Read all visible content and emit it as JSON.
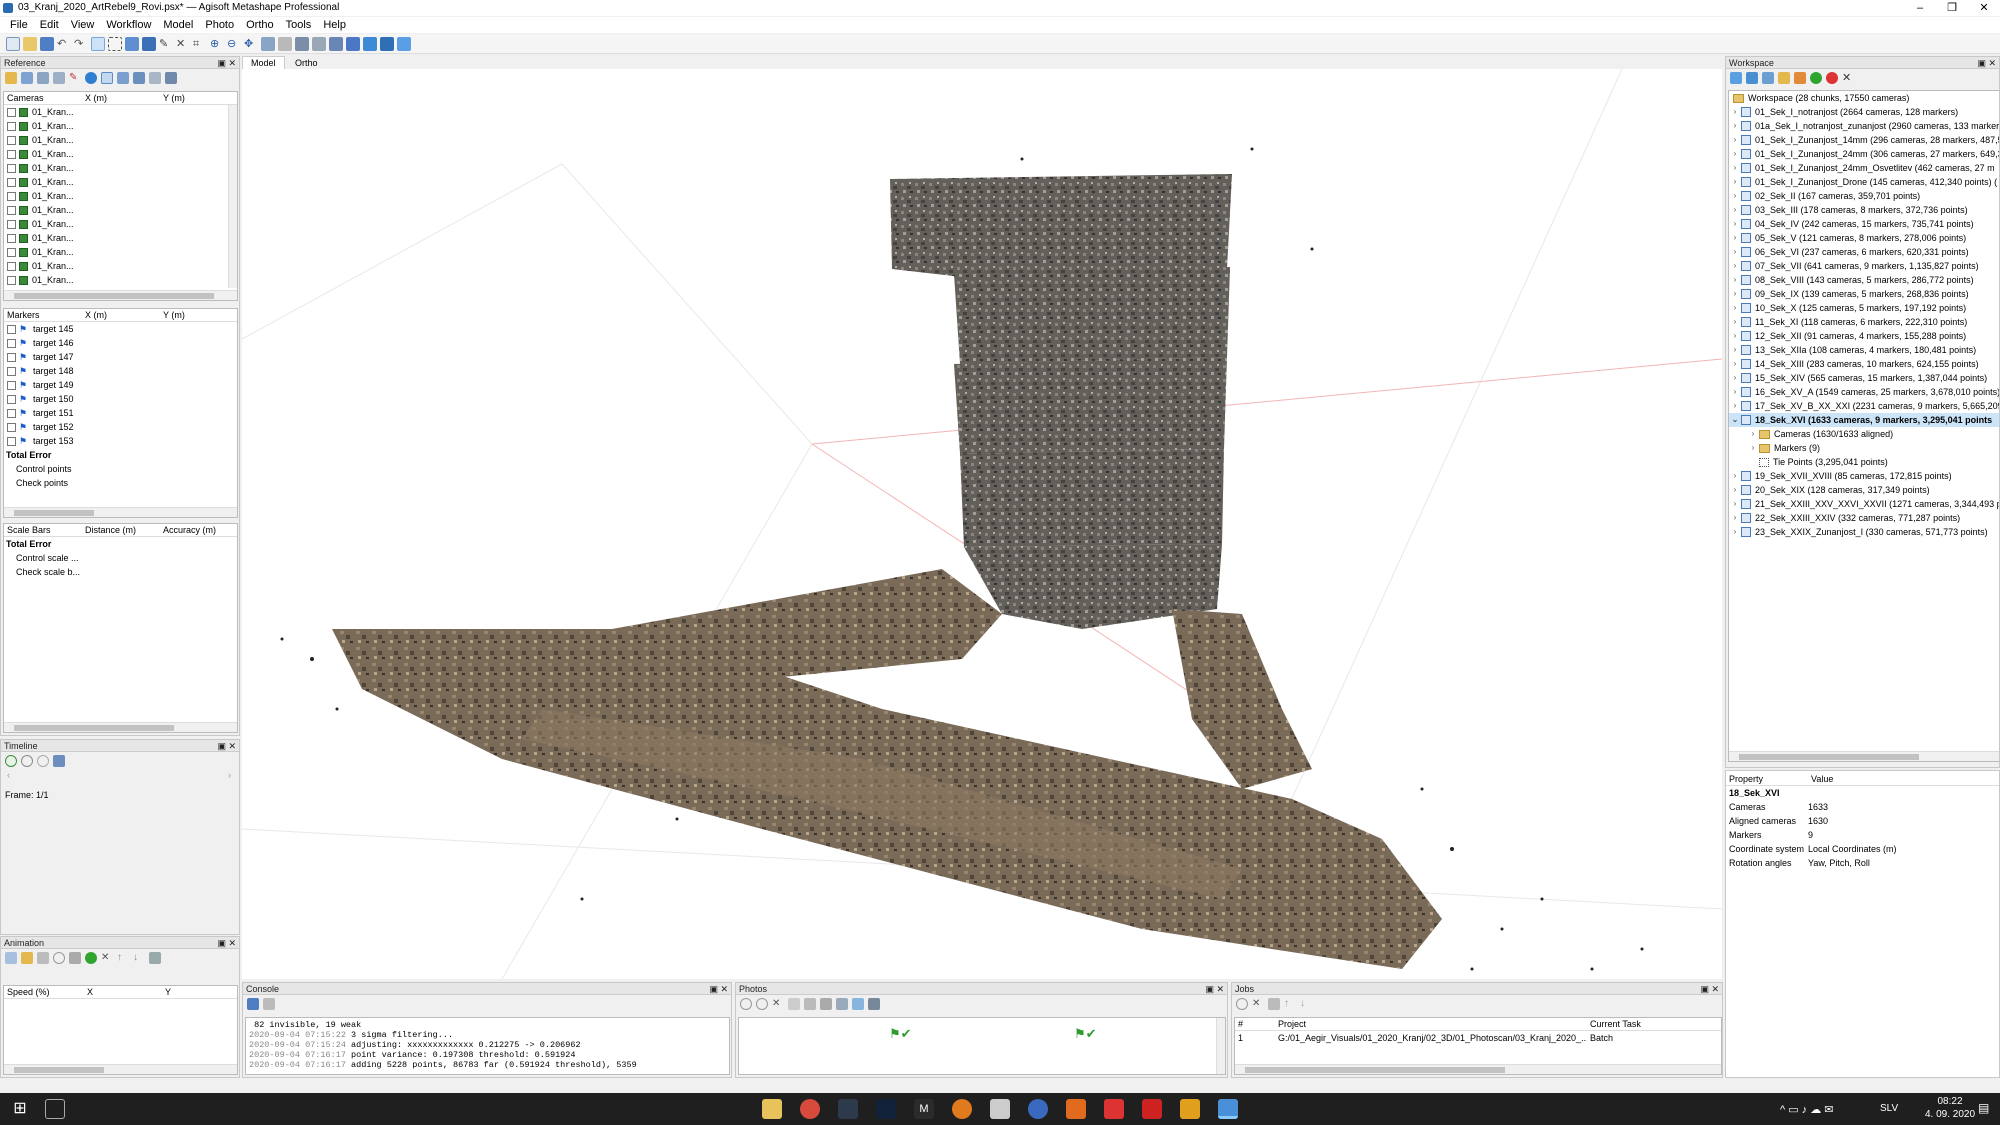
{
  "window": {
    "title": "03_Kranj_2020_ArtRebel9_Rovi.psx* — Agisoft Metashape Professional",
    "controls": [
      "–",
      "❐",
      "✕"
    ]
  },
  "menu": [
    "File",
    "Edit",
    "View",
    "Workflow",
    "Model",
    "Photo",
    "Ortho",
    "Tools",
    "Help"
  ],
  "view_tabs": [
    "Model",
    "Ortho"
  ],
  "reference": {
    "title": "Reference",
    "cameras_headers": [
      "Cameras",
      "X (m)",
      "Y (m)"
    ],
    "cameras": [
      "01_Kran...",
      "01_Kran...",
      "01_Kran...",
      "01_Kran...",
      "01_Kran...",
      "01_Kran...",
      "01_Kran...",
      "01_Kran...",
      "01_Kran...",
      "01_Kran...",
      "01_Kran...",
      "01_Kran...",
      "01_Kran..."
    ],
    "markers_headers": [
      "Markers",
      "X (m)",
      "Y (m)"
    ],
    "markers": [
      "target 145",
      "target 146",
      "target 147",
      "target 148",
      "target 149",
      "target 150",
      "target 151",
      "target 152",
      "target 153"
    ],
    "markers_total": "Total Error",
    "markers_sub": [
      "Control points",
      "Check points"
    ],
    "scalebars_headers": [
      "Scale Bars",
      "Distance (m)",
      "Accuracy (m)"
    ],
    "scalebars_total": "Total Error",
    "scalebars_sub": [
      "Control scale ...",
      "Check scale b..."
    ]
  },
  "timeline": {
    "title": "Timeline",
    "frame": "Frame: 1/1"
  },
  "animation": {
    "title": "Animation",
    "headers": [
      "Speed (%)",
      "X",
      "Y"
    ]
  },
  "console": {
    "title": "Console",
    "lines": [
      {
        "ts": "",
        "text": "82 invisible, 19 weak"
      },
      {
        "ts": "2020-09-04 07:15:22",
        "text": "3 sigma filtering..."
      },
      {
        "ts": "2020-09-04 07:15:24",
        "text": "adjusting: xxxxxxxxxxxxx 0.212275 -> 0.206962"
      },
      {
        "ts": "2020-09-04 07:16:17",
        "text": "point variance: 0.197308 threshold: 0.591924"
      },
      {
        "ts": "2020-09-04 07:16:17",
        "text": "adding 5228 points, 86783 far (0.591924 threshold), 5359"
      }
    ]
  },
  "photos": {
    "title": "Photos"
  },
  "jobs": {
    "title": "Jobs",
    "headers": [
      "#",
      "Project",
      "Current Task"
    ],
    "rows": [
      {
        "num": "1",
        "project": "G:/01_Aegir_Visuals/01_2020_Kranj/02_3D/01_Photoscan/03_Kranj_2020_...",
        "task": "Batch"
      }
    ]
  },
  "workspace": {
    "title": "Workspace",
    "root": "Workspace (28 chunks, 17550 cameras)",
    "chunks": [
      "01_Sek_I_notranjost (2664 cameras, 128 markers)",
      "01a_Sek_I_notranjost_zunanjost (2960 cameras, 133 markers",
      "01_Sek_I_Zunanjost_14mm (296 cameras, 28 markers, 487,5",
      "01_Sek_I_Zunanjost_24mm (306 cameras, 27 markers, 649,3",
      "01_Sek_I_Zunanjost_24mm_Osvetlitev (462 cameras, 27 m",
      "01_Sek_I_Zunanjost_Drone (145 cameras, 412,340 points) (",
      "02_Sek_II (167 cameras, 359,701 points)",
      "03_Sek_III (178 cameras, 8 markers, 372,736 points)",
      "04_Sek_IV (242 cameras, 15 markers, 735,741 points)",
      "05_Sek_V (121 cameras, 8 markers, 278,006 points)",
      "06_Sek_VI (237 cameras, 6 markers, 620,331 points)",
      "07_Sek_VII (641 cameras, 9 markers, 1,135,827 points)",
      "08_Sek_VIII (143 cameras, 5 markers, 286,772 points)",
      "09_Sek_IX (139 cameras, 5 markers, 268,836 points)",
      "10_Sek_X (125 cameras, 5 markers, 197,192 points)",
      "11_Sek_XI (118 cameras, 6 markers, 222,310 points)",
      "12_Sek_XII (91 cameras, 4 markers, 155,288 points)",
      "13_Sek_XIIa (108 cameras, 4 markers, 180,481 points)",
      "14_Sek_XIII (283 cameras, 10 markers, 624,155 points)",
      "15_Sek_XIV (565 cameras, 15 markers, 1,387,044 points)",
      "16_Sek_XV_A (1549 cameras, 25 markers, 3,678,010 points)",
      "17_Sek_XV_B_XX_XXI (2231 cameras, 9 markers, 5,665,209 p"
    ],
    "selected_chunk": "18_Sek_XVI (1633 cameras, 9 markers, 3,295,041 points",
    "selected_children": [
      "Cameras (1630/1633 aligned)",
      "Markers (9)",
      "Tie Points (3,295,041 points)"
    ],
    "chunks_after": [
      "19_Sek_XVII_XVIII (85 cameras, 172,815 points)",
      "20_Sek_XIX (128 cameras, 317,349 points)",
      "21_Sek_XXIII_XXV_XXVI_XXVII (1271 cameras, 3,344,493 poin",
      "22_Sek_XXIII_XXIV (332 cameras, 771,287 points)",
      "23_Sek_XXIX_Zunanjost_I (330 cameras, 571,773 points)"
    ]
  },
  "properties": {
    "headers": [
      "Property",
      "Value"
    ],
    "chunk_name": "18_Sek_XVI",
    "rows": [
      {
        "k": "Cameras",
        "v": "1633"
      },
      {
        "k": "Aligned cameras",
        "v": "1630"
      },
      {
        "k": "Markers",
        "v": "9"
      },
      {
        "k": "Coordinate system",
        "v": "Local Coordinates (m)"
      },
      {
        "k": "Rotation angles",
        "v": "Yaw, Pitch, Roll"
      }
    ]
  },
  "taskbar": {
    "time": "08:22",
    "date": "4. 09. 2020",
    "lang": "SLV"
  },
  "colors": {
    "accent": "#cce4f7",
    "taskbar": "#1f1f1f",
    "grid": "#e06a6a"
  }
}
